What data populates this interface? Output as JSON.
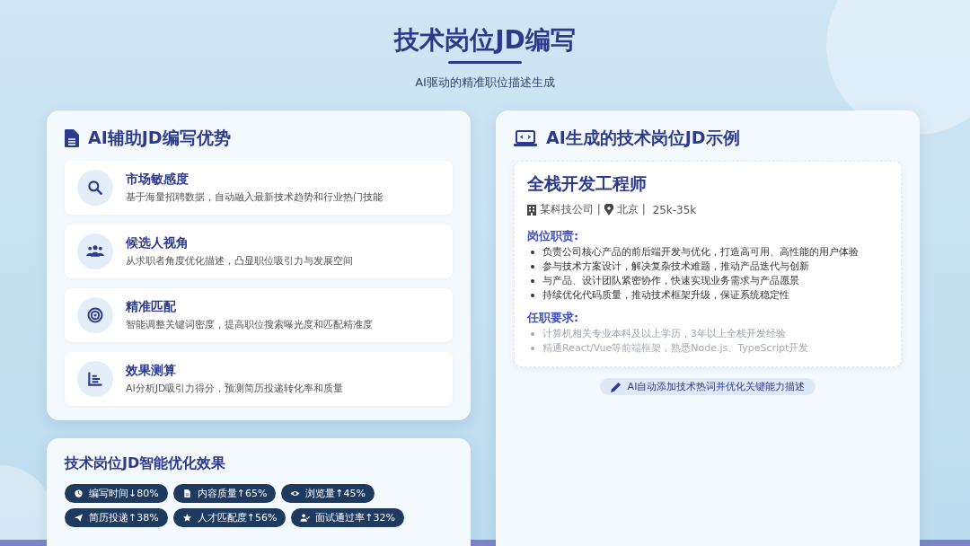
{
  "header": {
    "title": "技术岗位JD编写",
    "subtitle": "AI驱动的精准职位描述生成"
  },
  "advantages": {
    "title": "AI辅助JD编写优势",
    "items": [
      {
        "title": "市场敏感度",
        "desc": "基于海量招聘数据，自动融入最新技术趋势和行业热门技能"
      },
      {
        "title": "候选人视角",
        "desc": "从求职者角度优化描述，凸显职位吸引力与发展空间"
      },
      {
        "title": "精准匹配",
        "desc": "智能调整关键词密度，提高职位搜索曝光度和匹配精准度"
      },
      {
        "title": "效果测算",
        "desc": "AI分析JD吸引力得分，预测简历投递转化率和质量"
      }
    ]
  },
  "effects": {
    "title": "技术岗位JD智能优化效果",
    "tags": [
      "编写时间↓80%",
      "内容质量↑65%",
      "浏览量↑45%",
      "简历投递↑38%",
      "人才匹配度↑56%",
      "面试通过率↑32%"
    ]
  },
  "example": {
    "title": "AI生成的技术岗位JD示例",
    "job_title": "全栈开发工程师",
    "company": "某科技公司 |",
    "location": "北京 |",
    "salary": "25k-35k",
    "sections": [
      {
        "heading": "岗位职责:",
        "items": [
          "负责公司核心产品的前后端开发与优化，打造高可用、高性能的用户体验",
          "参与技术方案设计，解决复杂技术难题，推动产品迭代与创新",
          "与产品、设计团队紧密协作，快速实现业务需求与产品愿景",
          "持续优化代码质量，推动技术框架升级，保证系统稳定性"
        ]
      },
      {
        "heading": "任职要求:",
        "items": [
          "计算机相关专业本科及以上学历，3年以上全栈开发经验",
          "精通React/Vue等前端框架，熟悉Node.js、TypeScript开发"
        ]
      }
    ],
    "note": "AI自动添加技术热词并优化关键能力描述"
  }
}
